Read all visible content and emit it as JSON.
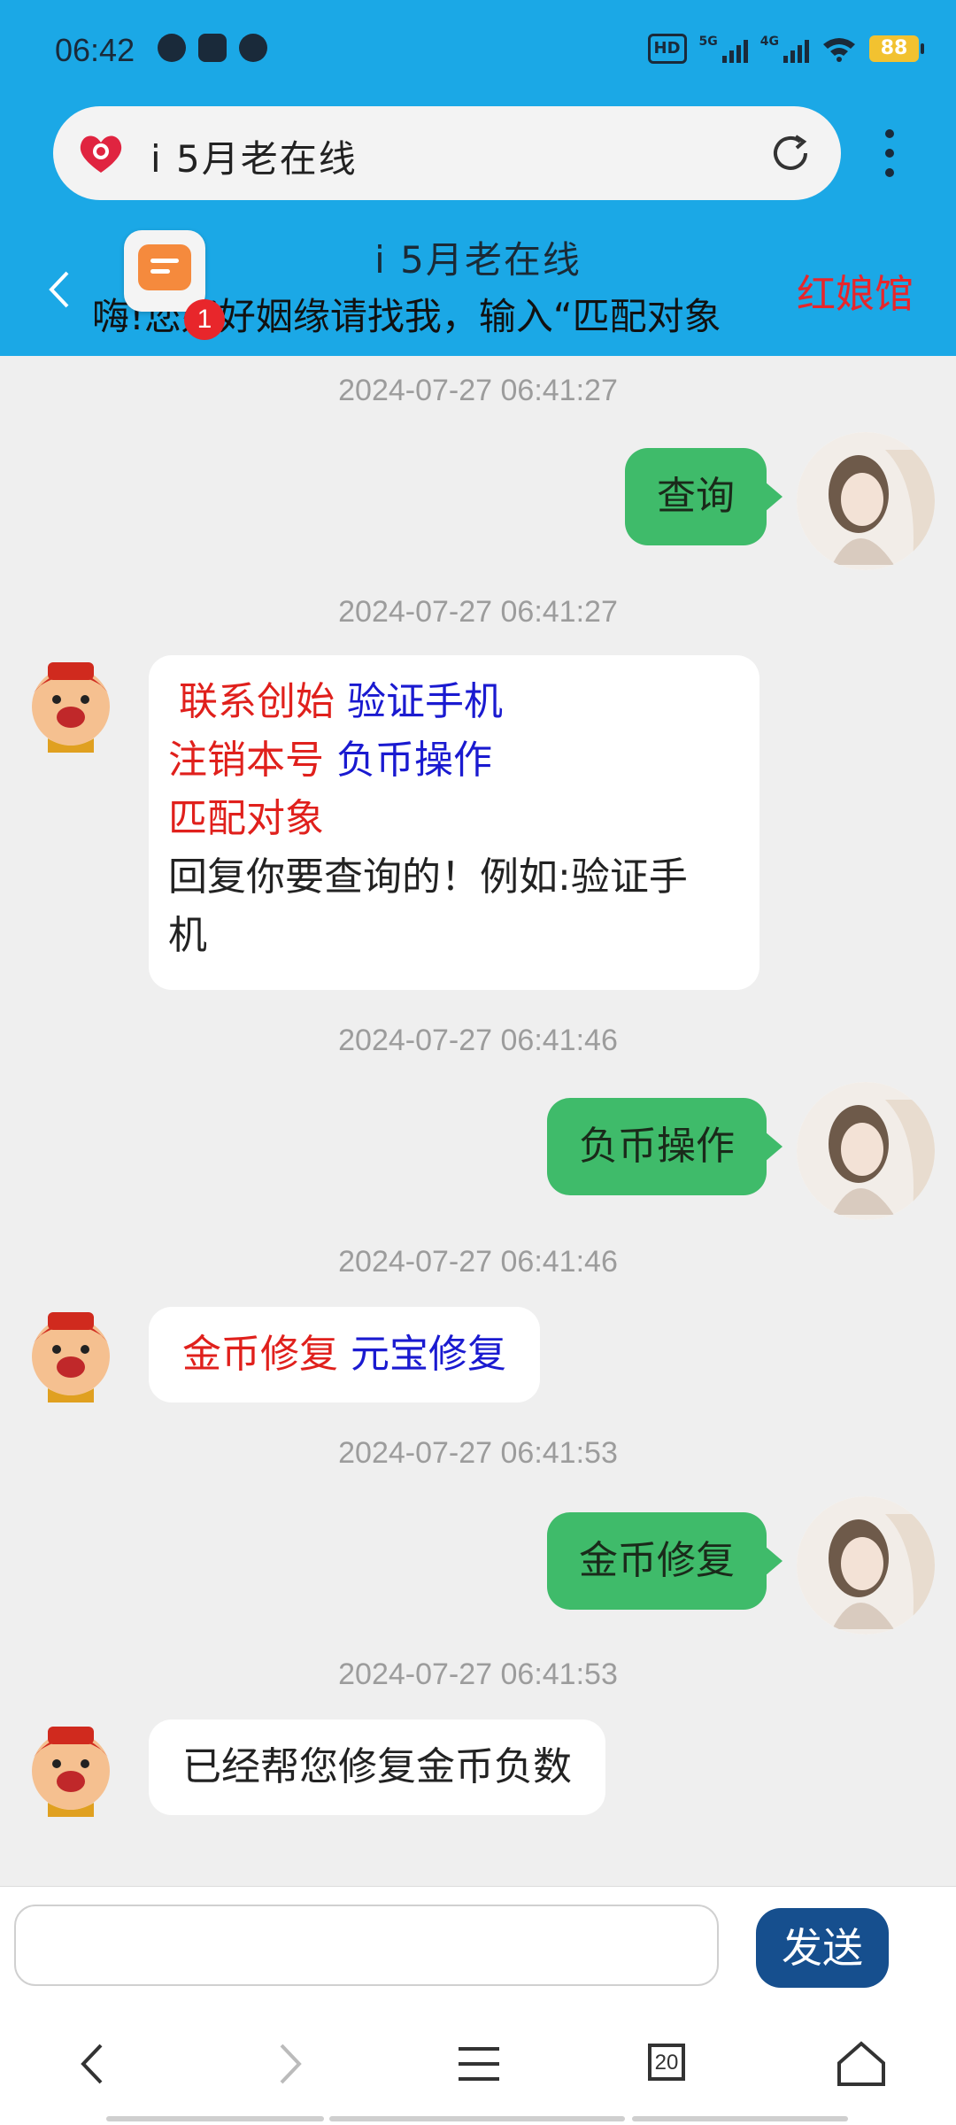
{
  "status_bar": {
    "time": "06:42",
    "network_1": "5G",
    "network_2": "4G",
    "battery": "88",
    "hd": "HD"
  },
  "browser": {
    "url_text": "i 5月老在线"
  },
  "chat_header": {
    "title": "i 5月老在线",
    "marquee": "嗨!您好好姻缘请找我，输入“匹配对象",
    "right_label": "红娘馆",
    "badge_count": "1"
  },
  "messages": [
    {
      "timestamp": "2024-07-27 06:41:27",
      "side": "right",
      "text": "查询"
    },
    {
      "timestamp": "2024-07-27 06:41:27",
      "side": "left",
      "lines": [
        {
          "parts": [
            {
              "text": "联系创始",
              "color": "red"
            },
            {
              "text": "验证手机",
              "color": "blue"
            }
          ]
        },
        {
          "parts": [
            {
              "text": "注销本号",
              "color": "red"
            },
            {
              "text": "负币操作",
              "color": "blue"
            }
          ]
        },
        {
          "parts": [
            {
              "text": "匹配对象",
              "color": "red"
            }
          ]
        },
        {
          "parts": [
            {
              "text": "回复你要查询的！例如:验证手",
              "color": "black"
            }
          ]
        },
        {
          "parts": [
            {
              "text": "机",
              "color": "black"
            }
          ]
        }
      ]
    },
    {
      "timestamp": "2024-07-27 06:41:46",
      "side": "right",
      "text": "负币操作"
    },
    {
      "timestamp": "2024-07-27 06:41:46",
      "side": "left",
      "lines": [
        {
          "parts": [
            {
              "text": "金币修复",
              "color": "red"
            },
            {
              "text": "元宝修复",
              "color": "blue"
            }
          ]
        }
      ]
    },
    {
      "timestamp": "2024-07-27 06:41:53",
      "side": "right",
      "text": "金币修复"
    },
    {
      "timestamp": "2024-07-27 06:41:53",
      "side": "left",
      "lines": [
        {
          "parts": [
            {
              "text": "已经帮您修复金币负数",
              "color": "black"
            }
          ]
        }
      ]
    }
  ],
  "composer": {
    "placeholder": "",
    "send_label": "发送"
  },
  "nav": {
    "tabs_count": "20"
  },
  "colors": {
    "header_bg": "#1ba8e6",
    "bubble_right": "#3fbb6a",
    "send_button": "#164f8e",
    "accent_red": "#e0201c",
    "accent_blue": "#1a1ad0"
  }
}
